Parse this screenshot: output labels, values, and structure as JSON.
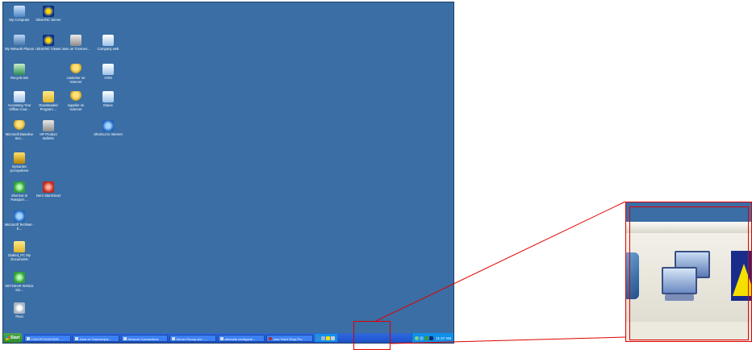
{
  "desktop": {
    "icons": [
      {
        "label": "My Computer",
        "icon": "computer-icon"
      },
      {
        "label": "UltraVNC Server",
        "icon": "vnc-server-icon"
      },
      {
        "label": "My Network Places",
        "icon": "network-places-icon"
      },
      {
        "label": "UltraVNC Viewer",
        "icon": "vnc-viewer-icon"
      },
      {
        "label": "Jane on Tcserver...",
        "icon": "shortcut-icon"
      },
      {
        "label": "Company web",
        "icon": "web-doc-icon"
      },
      {
        "label": "Recycle Bin",
        "icon": "recycle-bin-icon"
      },
      {
        "label": "customer on tcserver",
        "icon": "user-icon"
      },
      {
        "label": "CRM",
        "icon": "document-icon"
      },
      {
        "label": "Accessing Your Offline Cour...",
        "icon": "document-icon"
      },
      {
        "label": "Downloaded Program ...",
        "icon": "folder-icon"
      },
      {
        "label": "supplier on tcserver",
        "icon": "user-icon"
      },
      {
        "label": "Elaine",
        "icon": "document-icon"
      },
      {
        "label": "Microsoft Baseline Sec...",
        "icon": "security-icon"
      },
      {
        "label": "HP Product Bulletin",
        "icon": "building-icon"
      },
      {
        "label": "Shortcut to Internet",
        "icon": "internet-icon"
      },
      {
        "label": "Symantec pcAnywhere",
        "icon": "symantec-icon"
      },
      {
        "label": "Shortcut to Passport ...",
        "icon": "passport-icon"
      },
      {
        "label": "Nero StartSmart",
        "icon": "nero-icon"
      },
      {
        "label": "Microsoft TechNet - E...",
        "icon": "technet-icon"
      },
      {
        "label": "Dialled_PC My Documents",
        "icon": "my-documents-icon"
      },
      {
        "label": "NETGEAR WG511 Sm...",
        "icon": "netgear-icon"
      },
      {
        "label": "Pivot",
        "icon": "gear-icon"
      }
    ]
  },
  "taskbar": {
    "start_label": "Start",
    "tasks": [
      "CSKOFOSOE2005 - ...",
      "Jane on Tcserver(ca...",
      "Network Connections",
      "Server Runup.doc - ...",
      "alternate configurat...",
      "Jasc Paint Shop Pro"
    ],
    "clock": "11:47 AM"
  },
  "colors": {
    "desktop": "#3a6ea5",
    "taskbar": "#245edb",
    "start": "#2d8a2d",
    "callout": "#e00000"
  }
}
